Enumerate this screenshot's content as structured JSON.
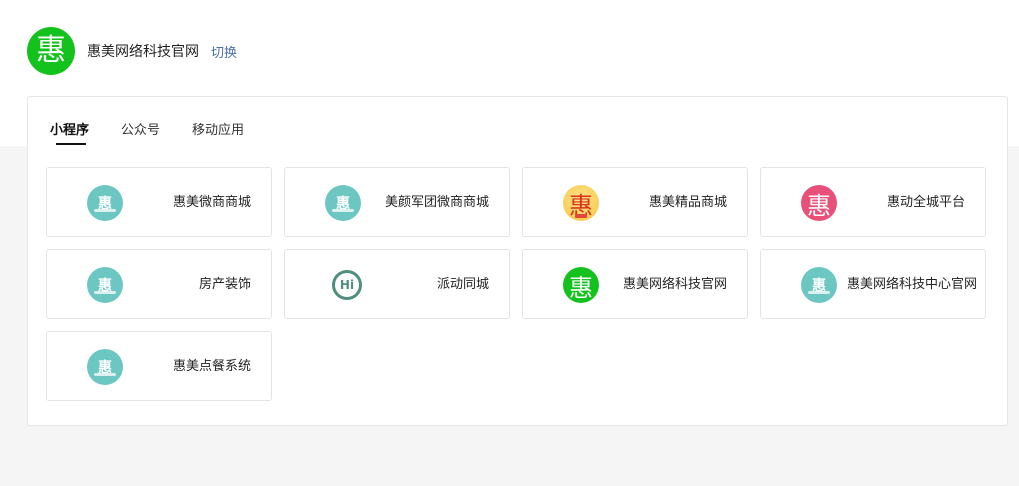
{
  "header": {
    "logo_glyph": "惠",
    "company_name": "惠美网络科技官网",
    "switch_label": "切换"
  },
  "tabs": [
    {
      "label": "小程序",
      "active": true
    },
    {
      "label": "公众号",
      "active": false
    },
    {
      "label": "移动应用",
      "active": false
    }
  ],
  "apps": [
    {
      "name": "惠美微商商城",
      "icon": "hui-teal-icon",
      "glyph": "惠"
    },
    {
      "name": "美颜军团微商商城",
      "icon": "hui-teal-icon",
      "glyph": "惠"
    },
    {
      "name": "惠美精品商城",
      "icon": "hui-gold-icon",
      "glyph": "惠"
    },
    {
      "name": "惠动全城平台",
      "icon": "hui-pink-icon",
      "glyph": "惠"
    },
    {
      "name": "房产装饰",
      "icon": "hui-teal-icon",
      "glyph": "惠"
    },
    {
      "name": "派动同城",
      "icon": "hi-ring-icon",
      "glyph": "Hi"
    },
    {
      "name": "惠美网络科技官网",
      "icon": "hui-green-icon",
      "glyph": "惠"
    },
    {
      "name": "惠美网络科技中心官网",
      "icon": "hui-teal-icon",
      "glyph": "惠"
    },
    {
      "name": "惠美点餐系统",
      "icon": "hui-teal-icon",
      "glyph": "惠"
    }
  ],
  "colors": {
    "brand_green": "#14c21e",
    "teal": "#6cc7c2",
    "pink": "#e8507a",
    "link_blue": "#4a6ea9"
  }
}
